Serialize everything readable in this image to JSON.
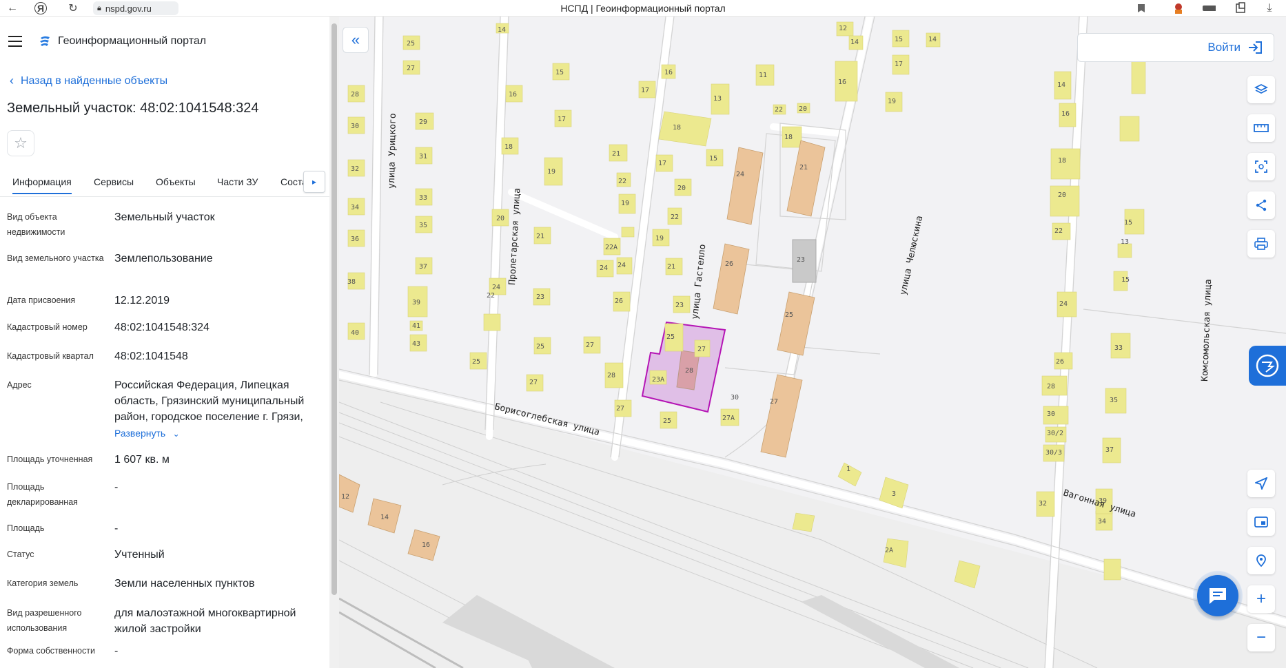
{
  "browser": {
    "url": "nspd.gov.ru",
    "tab_title": "НСПД | Геоинформационный портал"
  },
  "sidebar": {
    "app_name": "Геоинформационный портал",
    "back_label": "Назад в найденные объекты",
    "object_title": "Земельный участок: 48:02:1041548:324",
    "tabs": [
      {
        "label": "Информация",
        "active": true
      },
      {
        "label": "Сервисы"
      },
      {
        "label": "Объекты"
      },
      {
        "label": "Части ЗУ"
      },
      {
        "label": "Соста"
      }
    ],
    "properties": [
      {
        "label": "Вид объекта недвижимости",
        "value": "Земельный участок"
      },
      {
        "label": "Вид земельного участка",
        "value": "Землепользование"
      },
      {
        "label": "Дата присвоения",
        "value": "12.12.2019"
      },
      {
        "label": "Кадастровый номер",
        "value": "48:02:1041548:324"
      },
      {
        "label": "Кадастровый квартал",
        "value": "48:02:1041548"
      },
      {
        "label": "Адрес",
        "value": "Российская Федерация, Липецкая область, Грязинский муниципальный район, городское поселение г. Грязи,"
      },
      {
        "label": "Площадь уточненная",
        "value": "1 607 кв. м"
      },
      {
        "label": "Площадь декларированная",
        "value": "-"
      },
      {
        "label": "Площадь",
        "value": "-"
      },
      {
        "label": "Статус",
        "value": "Учтенный"
      },
      {
        "label": "Категория земель",
        "value": "Земли населенных пунктов"
      },
      {
        "label": "Вид разрешенного использования",
        "value": "для малоэтажной многоквартирной жилой застройки"
      },
      {
        "label": "Форма собственности",
        "value": "-"
      }
    ],
    "expand_label": "Развернуть"
  },
  "map": {
    "login_label": "Войти",
    "streets": [
      "улица Урицкого",
      "Пролетарская улица",
      "улица Гастелло",
      "улица Челюскина",
      "Комсомольская улица",
      "Борисоглебская улица",
      "Вагонная улица"
    ],
    "buildings": [
      "25",
      "27",
      "28",
      "30",
      "32",
      "34",
      "36",
      "38",
      "40",
      "29",
      "31",
      "33",
      "35",
      "37",
      "39",
      "41",
      "43",
      "25",
      "14",
      "15",
      "16",
      "18",
      "17",
      "19",
      "16",
      "20",
      "18",
      "22",
      "20",
      "19",
      "21",
      "21",
      "23",
      "22",
      "24",
      "25",
      "27",
      "26",
      "28",
      "27",
      "22А",
      "24",
      "21",
      "23",
      "23А",
      "25",
      "27А",
      "30",
      "11",
      "13",
      "15",
      "17",
      "14",
      "12",
      "16",
      "17",
      "19",
      "21",
      "22",
      "20",
      "24",
      "26",
      "28",
      "23",
      "25",
      "27",
      "15",
      "17",
      "19",
      "14",
      "16",
      "18",
      "20",
      "22",
      "24",
      "26",
      "28",
      "30",
      "30/2",
      "30/3",
      "32",
      "34",
      "33",
      "35",
      "37",
      "39",
      "13",
      "15",
      "1",
      "3",
      "2А",
      "12",
      "14",
      "16"
    ],
    "accent_color": "#1e6fd9",
    "parcel_color": "#b515b5"
  }
}
